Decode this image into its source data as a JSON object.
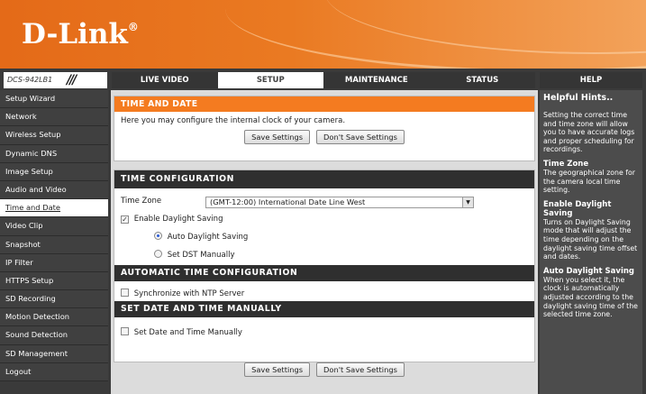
{
  "brand": {
    "logo": "D-Link",
    "logo_mark": "®"
  },
  "model": "DCS-942LB1",
  "tabs": [
    {
      "label": "LIVE VIDEO"
    },
    {
      "label": "SETUP"
    },
    {
      "label": "MAINTENANCE"
    },
    {
      "label": "STATUS"
    }
  ],
  "help_tab": "HELP",
  "sidebar": {
    "items": [
      {
        "label": "Setup Wizard"
      },
      {
        "label": "Network"
      },
      {
        "label": "Wireless Setup"
      },
      {
        "label": "Dynamic DNS"
      },
      {
        "label": "Image Setup"
      },
      {
        "label": "Audio and Video"
      },
      {
        "label": "Time and Date"
      },
      {
        "label": "Video Clip"
      },
      {
        "label": "Snapshot"
      },
      {
        "label": "IP Filter"
      },
      {
        "label": "HTTPS Setup"
      },
      {
        "label": "SD Recording"
      },
      {
        "label": "Motion Detection"
      },
      {
        "label": "Sound Detection"
      },
      {
        "label": "SD Management"
      },
      {
        "label": "Logout"
      }
    ]
  },
  "main": {
    "title": "TIME AND DATE",
    "intro": "Here you may configure the internal clock of your camera.",
    "save_label": "Save Settings",
    "dont_save_label": "Don't Save Settings",
    "config_title": "TIME CONFIGURATION",
    "time_zone_label": "Time Zone",
    "time_zone_value": "(GMT-12:00) International Date Line West",
    "enable_dst_label": "Enable Daylight Saving",
    "enable_dst_checked": true,
    "auto_dst_label": "Auto Daylight Saving",
    "set_dst_label": "Set DST Manually",
    "auto_title": "AUTOMATIC TIME CONFIGURATION",
    "ntp_label": "Synchronize with NTP Server",
    "manual_title": "SET DATE AND TIME MANUALLY",
    "manual_label": "Set Date and Time Manually"
  },
  "help": {
    "title": "Helpful Hints..",
    "intro": "Setting the correct time and time zone will allow you to have accurate logs and proper scheduling for recordings.",
    "tz_title": "Time Zone",
    "tz_text": "The geographical zone for the camera local time setting.",
    "dst_title": "Enable Daylight Saving",
    "dst_text": "Turns on Daylight Saving mode that will adjust the time depending on the daylight saving time offset and dates.",
    "auto_title": "Auto Daylight Saving",
    "auto_text": "When you select it, the clock is automatically adjusted according to the daylight saving time of the selected time zone."
  },
  "colors": {
    "accent": "#f47b20",
    "header": "#e46a18",
    "dark": "#2f2f2f"
  }
}
